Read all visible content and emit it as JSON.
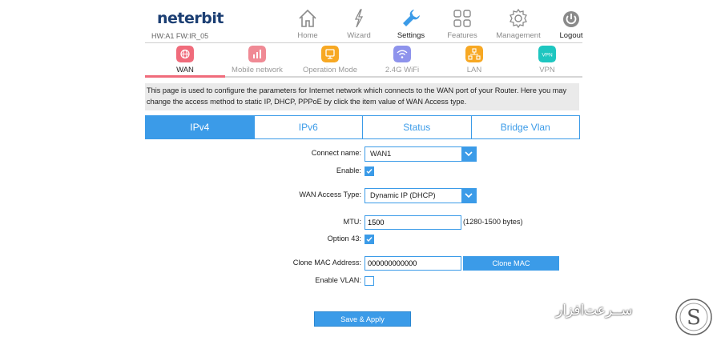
{
  "brand": {
    "logo": "neterbit",
    "hw_info": "HW:A1 FW:IR_05"
  },
  "top_nav": [
    {
      "label": "Home",
      "icon": "home-icon"
    },
    {
      "label": "Wizard",
      "icon": "wizard-icon"
    },
    {
      "label": "Settings",
      "icon": "wrench-icon",
      "active": true
    },
    {
      "label": "Features",
      "icon": "grid-icon"
    },
    {
      "label": "Management",
      "icon": "gear-icon"
    },
    {
      "label": "Logout",
      "icon": "power-icon"
    }
  ],
  "sub_nav": [
    {
      "label": "WAN",
      "icon": "globe-icon",
      "color": "#f06b7b",
      "active": true
    },
    {
      "label": "Mobile network",
      "icon": "signal-icon",
      "color": "#f06b7b"
    },
    {
      "label": "Operation Mode",
      "icon": "monitor-icon",
      "color": "#f7a823"
    },
    {
      "label": "2.4G WiFi",
      "icon": "wifi-icon",
      "color": "#7b7fe8"
    },
    {
      "label": "LAN",
      "icon": "lan-icon",
      "color": "#f7a823"
    },
    {
      "label": "VPN",
      "icon": "vpn-icon",
      "color": "#1ec6c0",
      "badge": "VPN"
    }
  ],
  "description": "This page is used to configure the parameters for Internet network which connects to the WAN port of your Router. Here you may change the access method to static IP, DHCP, PPPoE by click the item value of WAN Access type.",
  "tabs": [
    {
      "label": "IPv4",
      "active": true
    },
    {
      "label": "IPv6"
    },
    {
      "label": "Status"
    },
    {
      "label": "Bridge Vlan"
    }
  ],
  "form": {
    "connect_name": {
      "label": "Connect name:",
      "value": "WAN1"
    },
    "enable": {
      "label": "Enable:",
      "checked": true
    },
    "wan_access_type": {
      "label": "WAN Access Type:",
      "value": "Dynamic IP (DHCP)"
    },
    "mtu": {
      "label": "MTU:",
      "value": "1500",
      "hint": "(1280-1500 bytes)"
    },
    "option43": {
      "label": "Option 43:",
      "checked": true
    },
    "clone_mac": {
      "label": "Clone MAC Address:",
      "value": "000000000000",
      "button": "Clone MAC"
    },
    "enable_vlan": {
      "label": "Enable VLAN:",
      "checked": false
    },
    "save_button": "Save & Apply"
  },
  "watermark": {
    "text": "ســرعت‌افزار",
    "letter": "S"
  },
  "colors": {
    "accent": "#3b9be8",
    "wan_active": "#f06b7b"
  }
}
